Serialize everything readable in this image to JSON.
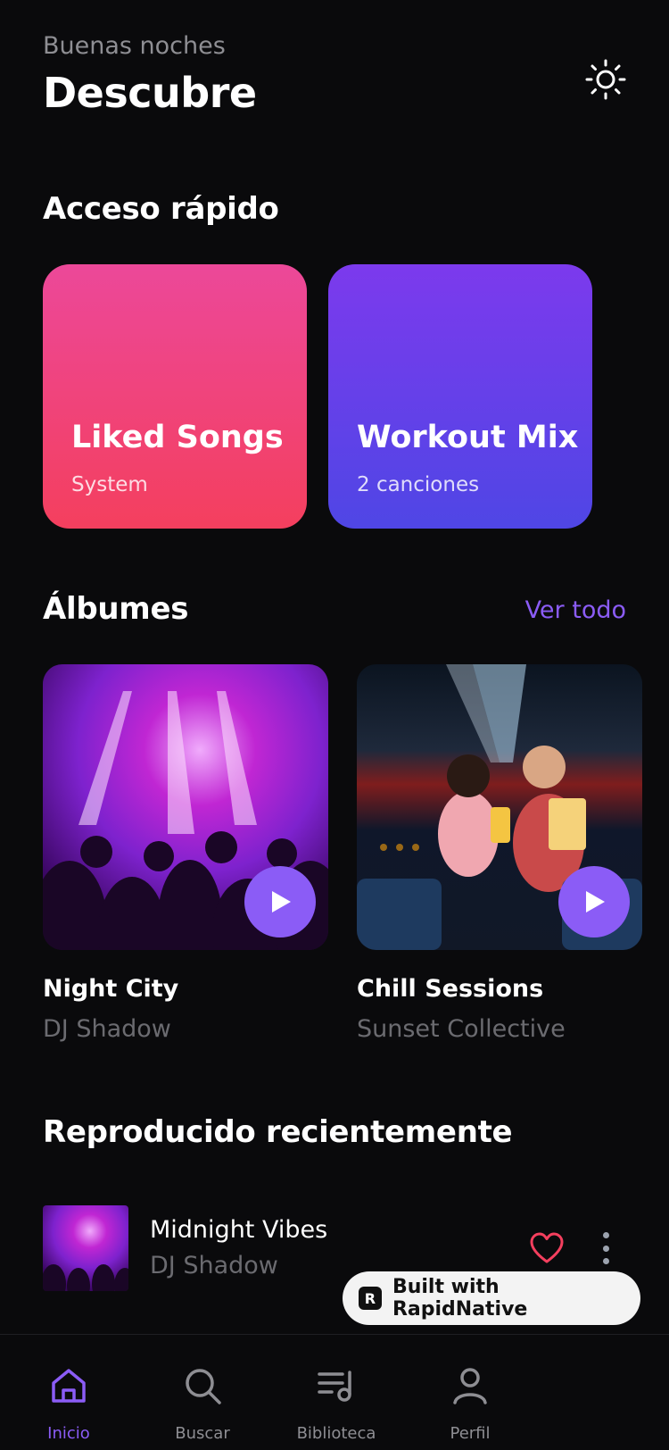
{
  "header": {
    "greeting": "Buenas noches",
    "title": "Descubre",
    "theme_icon": "sun-icon"
  },
  "quick_access": {
    "title": "Acceso rápido",
    "cards": [
      {
        "name": "Liked Songs",
        "subtitle": "System",
        "color_from": "#ec4899",
        "color_to": "#f43f5e"
      },
      {
        "name": "Workout Mix",
        "subtitle": "2 canciones",
        "color_from": "#7c3aed",
        "color_to": "#4f46e5"
      }
    ]
  },
  "albums": {
    "title": "Álbumes",
    "see_all": "Ver todo",
    "items": [
      {
        "name": "Night City",
        "artist": "DJ Shadow"
      },
      {
        "name": "Chill Sessions",
        "artist": "Sunset Collective"
      }
    ]
  },
  "recent": {
    "title": "Reproducido recientemente",
    "items": [
      {
        "title": "Midnight Vibes",
        "artist": "DJ Shadow"
      }
    ]
  },
  "badge": {
    "logo": "R",
    "text": "Built with RapidNative"
  },
  "tabbar": {
    "tabs": [
      {
        "label": "Inicio",
        "icon": "home-icon",
        "active": true
      },
      {
        "label": "Buscar",
        "icon": "search-icon",
        "active": false
      },
      {
        "label": "Biblioteca",
        "icon": "library-icon",
        "active": false
      },
      {
        "label": "Perfil",
        "icon": "profile-icon",
        "active": false
      }
    ]
  },
  "colors": {
    "background": "#0a0a0c",
    "accent": "#8b5cf6",
    "heart": "#f43f5e",
    "muted_text": "#6b6b70"
  }
}
